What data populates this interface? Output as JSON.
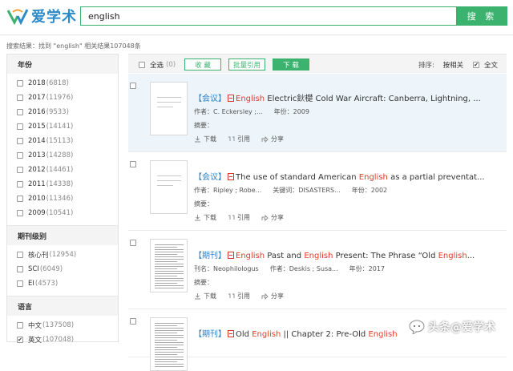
{
  "header": {
    "logo_text": "爱学术",
    "search_value": "english",
    "search_button": "搜 索"
  },
  "summary": "搜索结果：找到 \"english\" 相关结果107048条",
  "sidebar": {
    "groups": [
      {
        "title": "年份",
        "items": [
          {
            "label": "2018",
            "count": "(6818)",
            "checked": false
          },
          {
            "label": "2017",
            "count": "(11976)",
            "checked": false
          },
          {
            "label": "2016",
            "count": "(9533)",
            "checked": false
          },
          {
            "label": "2015",
            "count": "(14141)",
            "checked": false
          },
          {
            "label": "2014",
            "count": "(15113)",
            "checked": false
          },
          {
            "label": "2013",
            "count": "(14288)",
            "checked": false
          },
          {
            "label": "2012",
            "count": "(14461)",
            "checked": false
          },
          {
            "label": "2011",
            "count": "(14338)",
            "checked": false
          },
          {
            "label": "2010",
            "count": "(11346)",
            "checked": false
          },
          {
            "label": "2009",
            "count": "(10541)",
            "checked": false
          }
        ]
      },
      {
        "title": "期刊级别",
        "items": [
          {
            "label": "核心刊",
            "count": "(12954)",
            "checked": false
          },
          {
            "label": "SCI",
            "count": "(6049)",
            "checked": false
          },
          {
            "label": "EI",
            "count": "(4573)",
            "checked": false
          }
        ]
      },
      {
        "title": "语言",
        "items": [
          {
            "label": "中文",
            "count": "(137508)",
            "checked": false
          },
          {
            "label": "英文",
            "count": "(107048)",
            "checked": true
          }
        ]
      }
    ]
  },
  "toolbar": {
    "select_all": "全选",
    "select_count": "(0)",
    "collect": "收 藏",
    "batch_cite": "批量引用",
    "download": "下 载",
    "sort_label": "排序:",
    "sort_value": "按相关",
    "fulltext": "全文",
    "fulltext_checked": true
  },
  "results": [
    {
      "type": "【会议】",
      "title_parts": [
        {
          "t": "English",
          "hl": true
        },
        {
          "t": " Electric鈥檚 Cold War Aircraft: Canberra, Lightning, ...",
          "hl": false
        }
      ],
      "meta": [
        {
          "label": "作者：",
          "value": "C. Eckersley ;..."
        },
        {
          "label": "年份：",
          "value": "2009"
        }
      ],
      "abstract_label": "摘要：",
      "actions": [
        "下载",
        "引用",
        "分享"
      ],
      "highlighted": true
    },
    {
      "type": "【会议】",
      "title_parts": [
        {
          "t": "The use of standard American ",
          "hl": false
        },
        {
          "t": "English",
          "hl": true
        },
        {
          "t": " as a partial preventat...",
          "hl": false
        }
      ],
      "meta": [
        {
          "label": "作者：",
          "value": "Ripley ; Robe..."
        },
        {
          "label": "关键词：",
          "value": "DISASTERS..."
        },
        {
          "label": "年份：",
          "value": "2002"
        }
      ],
      "abstract_label": "摘要：",
      "actions": [
        "下载",
        "引用",
        "分享"
      ],
      "highlighted": false
    },
    {
      "type": "【期刊】",
      "title_parts": [
        {
          "t": "English",
          "hl": true
        },
        {
          "t": " Past and ",
          "hl": false
        },
        {
          "t": "English",
          "hl": true
        },
        {
          "t": " Present: The Phrase  “Old ",
          "hl": false
        },
        {
          "t": "English",
          "hl": true
        },
        {
          "t": "...",
          "hl": false
        }
      ],
      "meta": [
        {
          "label": "刊名：",
          "value": "Neophilologus"
        },
        {
          "label": "作者：",
          "value": "Deskis ; Susa..."
        },
        {
          "label": "年份：",
          "value": "2017"
        }
      ],
      "abstract_label": "摘要：",
      "actions": [
        "下载",
        "引用",
        "分享"
      ],
      "highlighted": false
    },
    {
      "type": "【期刊】",
      "title_parts": [
        {
          "t": "Old ",
          "hl": false
        },
        {
          "t": "English",
          "hl": true
        },
        {
          "t": " || Chapter 2: Pre-Old ",
          "hl": false
        },
        {
          "t": "English",
          "hl": true
        }
      ],
      "meta": [],
      "abstract_label": "",
      "actions": [],
      "highlighted": false
    }
  ],
  "watermark": "头条@爱学术",
  "colors": {
    "accent": "#3cb26f",
    "highlight": "#e33a27",
    "type_blue": "#2e7fc2"
  }
}
